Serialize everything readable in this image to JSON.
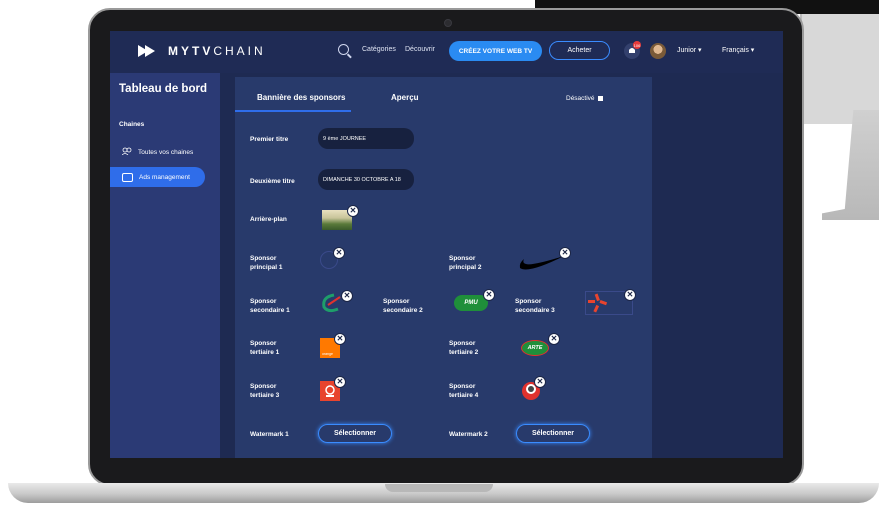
{
  "header": {
    "logo_bold": "MYTV",
    "logo_rest": "CHAIN",
    "nav_categories": "Catégories",
    "nav_discover": "Découvrir",
    "create_label": "CRÉEZ VOTRE WEB TV",
    "buy_label": "Acheter",
    "notification_count": "106",
    "user_name": "Junior ▾",
    "language": "Français ▾"
  },
  "sidebar": {
    "title": "Tableau de bord",
    "section": "Chaines",
    "items": [
      {
        "label": "Toutes vos chaines",
        "icon": "users-icon",
        "active": false
      },
      {
        "label": "Ads management",
        "icon": "ads-icon",
        "active": true
      }
    ]
  },
  "tabs": [
    {
      "label": "Bannière des sponsors",
      "active": true
    },
    {
      "label": "Aperçu",
      "active": false
    }
  ],
  "toggle_label": "Désactivé",
  "form": {
    "premier_titre_label": "Premier titre",
    "premier_titre_value": "9 ème JOURNEE",
    "deuxieme_titre_label": "Deuxième titre",
    "deuxieme_titre_value": "DIMANCHE 30 OCTOBRE A 18",
    "arriere_plan_label": "Arrière-plan"
  },
  "sponsors": {
    "principal_1": "Sponsor principal 1",
    "principal_2": "Sponsor principal 2",
    "secondaire_1": "Sponsor secondaire 1",
    "secondaire_2": "Sponsor secondaire 2",
    "secondaire_3": "Sponsor secondaire 3",
    "tertiaire_1": "Sponsor tertiaire 1",
    "tertiaire_2": "Sponsor tertiaire 2",
    "tertiaire_3": "Sponsor tertiaire 3",
    "tertiaire_4": "Sponsor tertiaire 4"
  },
  "logos": {
    "pmu_text": "PMU",
    "orange_text": "orange",
    "arte_text": "ARTE"
  },
  "watermarks": {
    "w1_label": "Watermark 1",
    "w2_label": "Watermark 2",
    "select_label": "Sélectionner"
  },
  "close_glyph": "✕",
  "colors": {
    "accent": "#2f6dea",
    "bg": "#1e2a52",
    "card": "#283a6b"
  }
}
